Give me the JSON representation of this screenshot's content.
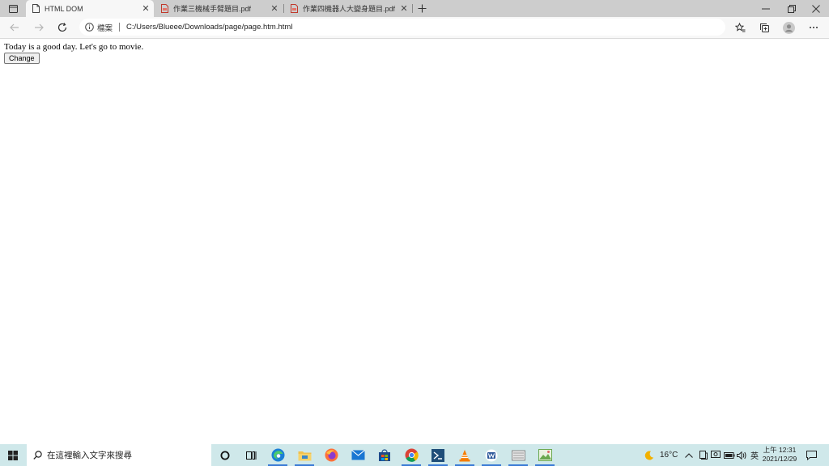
{
  "browser": {
    "tabs": [
      {
        "title": "HTML DOM",
        "active": true,
        "icon": "page-icon"
      },
      {
        "title": "作業三機械手臂題目.pdf",
        "active": false,
        "icon": "pdf-icon"
      },
      {
        "title": "作業四機器人大變身題目.pdf",
        "active": false,
        "icon": "pdf-icon"
      }
    ],
    "address": {
      "scheme_label": "檔案",
      "url": "C:/Users/Blueee/Downloads/page/page.htm.html"
    }
  },
  "page": {
    "text": "Today is a good day. Let's go to movie.",
    "button_label": "Change"
  },
  "taskbar": {
    "search_placeholder": "在這裡輸入文字來搜尋",
    "weather": "16°C",
    "ime": "英",
    "clock_time": "上午 12:31",
    "clock_date": "2021/12/29"
  },
  "colors": {
    "taskbar_bg": "#cfe8ea",
    "tabstrip_bg": "#cdcdcd",
    "toolbar_bg": "#f7f7f7",
    "accent": "#3a7bd5"
  }
}
